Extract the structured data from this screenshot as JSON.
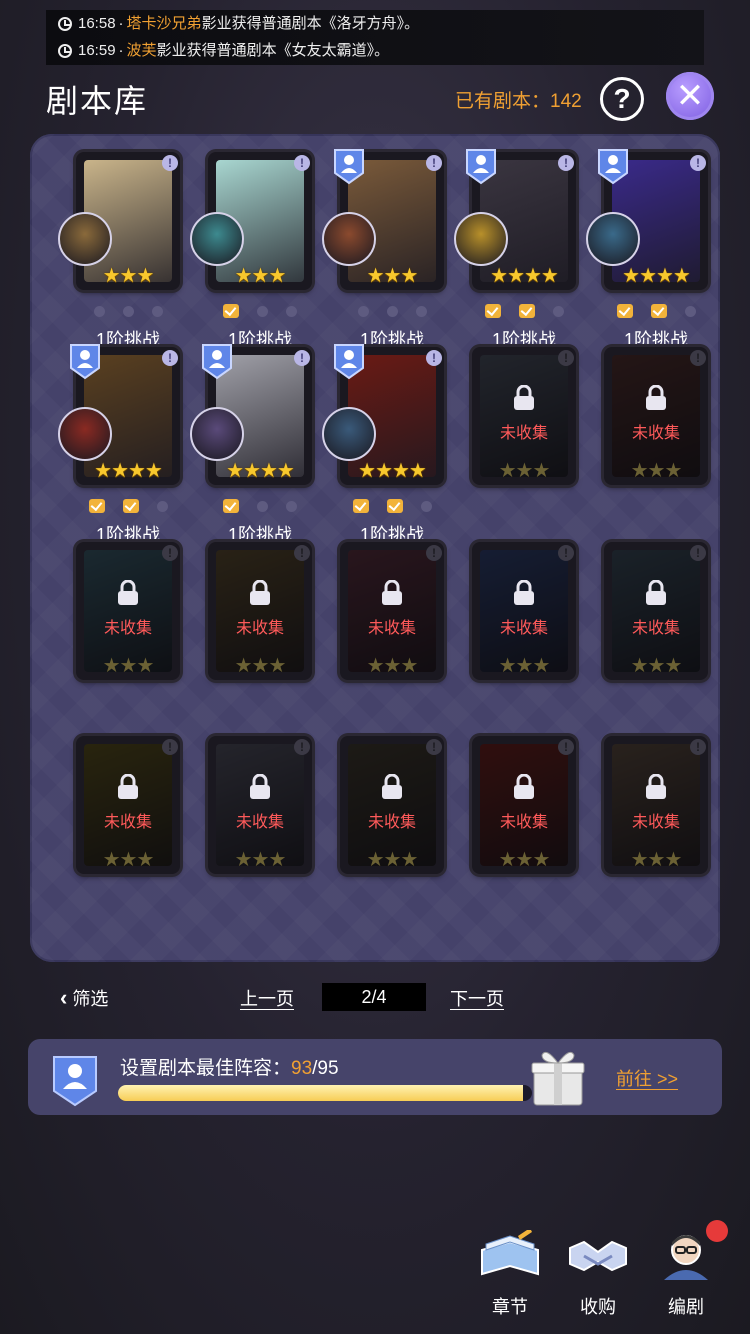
{
  "ticker": [
    {
      "time": "16:58",
      "sep": "·",
      "name": "塔卡沙兄弟",
      "text": "影业获得普通剧本《洛牙方舟》。"
    },
    {
      "time": "16:59",
      "sep": "·",
      "name": "波芙",
      "text": "影业获得普通剧本《女友太霸道》。"
    }
  ],
  "header": {
    "title": "剧本库",
    "owned_label": "已有剧本：",
    "owned_count": "142",
    "help": "?",
    "close": "✕"
  },
  "cards": [
    {
      "locked": false,
      "stars": "★★★",
      "badge": false,
      "art": "#c9b48a",
      "avatar": "#8a6a3b",
      "progress": [
        "dot",
        "dot",
        "dot"
      ],
      "challenge": "1阶挑战"
    },
    {
      "locked": false,
      "stars": "★★★",
      "badge": false,
      "art": "#a8d6d0",
      "avatar": "#3d8a8f",
      "progress": [
        "check",
        "dot",
        "dot"
      ],
      "challenge": "1阶挑战"
    },
    {
      "locked": false,
      "stars": "★★★",
      "badge": true,
      "art": "#7a5a3a",
      "avatar": "#8b4a2e",
      "progress": [
        "dot",
        "dot",
        "dot"
      ],
      "challenge": "1阶挑战"
    },
    {
      "locked": false,
      "stars": "★★★★",
      "badge": true,
      "art": "#3a3540",
      "avatar": "#b8902a",
      "progress": [
        "check",
        "check",
        "dot"
      ],
      "challenge": "1阶挑战"
    },
    {
      "locked": false,
      "stars": "★★★★",
      "badge": true,
      "art": "#3a2a8a",
      "avatar": "#3a6a8a",
      "progress": [
        "check",
        "check",
        "dot"
      ],
      "challenge": "1阶挑战"
    },
    {
      "locked": false,
      "stars": "★★★★",
      "badge": true,
      "art": "#5a4020",
      "avatar": "#8a2a22",
      "progress": [
        "check",
        "check",
        "dot"
      ],
      "challenge": "1阶挑战"
    },
    {
      "locked": false,
      "stars": "★★★★",
      "badge": true,
      "art": "#a0a0a8",
      "avatar": "#5a4a7a",
      "progress": [
        "check",
        "dot",
        "dot"
      ],
      "challenge": "1阶挑战"
    },
    {
      "locked": false,
      "stars": "★★★★",
      "badge": true,
      "art": "#6a1a14",
      "avatar": "#3a5a7a",
      "progress": [
        "check",
        "check",
        "dot"
      ],
      "challenge": "1阶挑战"
    },
    {
      "locked": true,
      "stars": "★★★",
      "art": "#4a5060",
      "label": "未收集"
    },
    {
      "locked": true,
      "stars": "★★★",
      "art": "#503030",
      "label": "未收集"
    },
    {
      "locked": true,
      "stars": "★★★",
      "art": "#3a5a6a",
      "label": "未收集"
    },
    {
      "locked": true,
      "stars": "★★★",
      "art": "#5a4a30",
      "label": "未收集"
    },
    {
      "locked": true,
      "stars": "★★★",
      "art": "#5a3040",
      "label": "未收集"
    },
    {
      "locked": true,
      "stars": "★★★",
      "art": "#304070",
      "label": "未收集"
    },
    {
      "locked": true,
      "stars": "★★★",
      "art": "#3a4a5a",
      "label": "未收集"
    },
    {
      "locked": true,
      "stars": "★★★",
      "art": "#5a5020",
      "label": "未收集"
    },
    {
      "locked": true,
      "stars": "★★★",
      "art": "#505060",
      "label": "未收集"
    },
    {
      "locked": true,
      "stars": "★★★",
      "art": "#403a30",
      "label": "未收集"
    },
    {
      "locked": true,
      "stars": "★★★",
      "art": "#6a2020",
      "label": "未收集"
    },
    {
      "locked": true,
      "stars": "★★★",
      "art": "#5a4a40",
      "label": "未收集"
    }
  ],
  "pager": {
    "filter": "筛选",
    "prev": "上一页",
    "page": "2/4",
    "next": "下一页"
  },
  "lineup": {
    "label": "设置剧本最佳阵容：",
    "current": "93",
    "total": "/95",
    "progress": 0.979,
    "goto": "前往 >>"
  },
  "bottom_nav": {
    "chapter": "章节",
    "acquire": "收购",
    "screenwriter": "编剧"
  },
  "colors": {
    "accent": "#f0a032",
    "star": "#f8c82d",
    "uncollected": "#ff5a5a",
    "panel": "#45426a"
  }
}
